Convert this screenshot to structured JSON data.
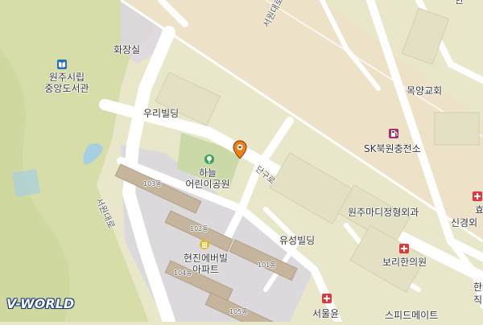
{
  "map": {
    "labels": {
      "restroom": "화장실",
      "library": "원주시립\n중앙도서관",
      "woori_building": "우리빌딩",
      "park": "하늘\n어린이공원",
      "seowon_daero_top": "서원대로",
      "seowon_daero_left": "서원대로",
      "mokyang_church": "목양교회",
      "sk_station": "SK북원충전소",
      "dangu_ro": "단구로",
      "wonju_madi": "원주마디정형외과",
      "yuseong_building": "유성빌딩",
      "bori_clinic": "보리한의원",
      "hyunjin_apt": "현진에버빌\n아파트",
      "speedmate": "스피드메이트",
      "seoul_clinic": "서울윤",
      "hyo_partial": "효성",
      "sinkyeong_partial": "신경외",
      "top_right_partial": "한",
      "bottom_right_partial_1": "한",
      "bottom_right_partial_2": "직"
    },
    "buildings": {
      "b103": "103동",
      "b102": "102동",
      "b101": "101동",
      "b104": "104동",
      "b105": "105동"
    },
    "logo": "V-WORLD",
    "icons": {
      "library": "library-icon",
      "park": "park-icon",
      "gas": "gas-station-icon",
      "hospital": "hospital-icon",
      "apartment": "apartment-icon",
      "marker": "location-pin-icon"
    },
    "colors": {
      "land": "#e9e7c9",
      "road": "#ffffff",
      "highway": "#ede2c8",
      "park": "#cbd9a9",
      "hill": "#c9d69a",
      "apartment_area": "#dcd9dd",
      "building": "#c6b59d",
      "water": "#a6cfe1",
      "hospital": "#e0383c",
      "library": "#2b6fb6",
      "gas": "#a0336b",
      "marker": "#f07f13"
    }
  }
}
